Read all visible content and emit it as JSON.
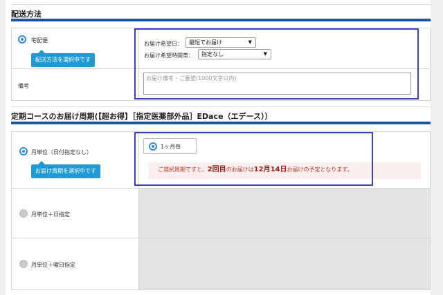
{
  "shipping": {
    "section_title": "配送方法",
    "method_label": "宅配便",
    "method_tooltip": "配送方法を選択中です",
    "date_label": "お届け希望日：",
    "date_value": "最短でお届け",
    "time_label": "お届け希望時間帯：",
    "time_value": "指定なし",
    "remarks_label": "備考",
    "remarks_placeholder": "お届け備考・ご要望(1000文字以内)"
  },
  "subscription": {
    "section_title": "定期コースのお届け周期(【超お得】［指定医薬部外品］EDace（エデース））",
    "options": [
      {
        "label": "月単位（日付指定なし）",
        "selected": true
      },
      {
        "label": "月単位＋日指定",
        "selected": false
      },
      {
        "label": "月単位＋曜日指定",
        "selected": false
      }
    ],
    "cycle_tooltip": "お届け周期を選択中です",
    "interval_option": "1ヶ月毎",
    "notice_prefix": "ご選択周期ですと、",
    "notice_count": "2回目",
    "notice_mid": "のお届けは",
    "notice_date": "12月14日",
    "notice_suffix": "お届けの予定となります。"
  },
  "colors": {
    "accent_bar": "#1a56a0",
    "tooltip": "#1e9ad6",
    "highlight": "#3f3fc5",
    "notice_text": "#c0392b"
  },
  "icons": {
    "select_arrow": "chevron-down-icon"
  }
}
